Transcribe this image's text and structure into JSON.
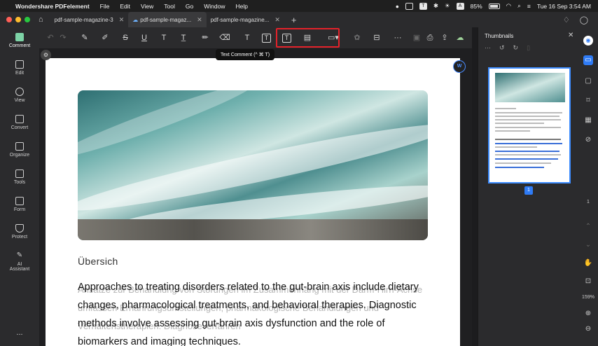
{
  "menubar": {
    "app_name": "Wondershare PDFelement",
    "items": [
      "File",
      "Edit",
      "View",
      "Tool",
      "Go",
      "Window",
      "Help"
    ],
    "battery": "85%",
    "datetime": "Tue 16 Sep  3:54 AM",
    "status_letter": "A"
  },
  "tabs": [
    {
      "label": "pdf-sample-magazine-3"
    },
    {
      "label": "pdf-sample-magaz..."
    },
    {
      "label": "pdf-sample-magazine..."
    }
  ],
  "sidebar": {
    "items": [
      {
        "label": "Comment"
      },
      {
        "label": "Edit"
      },
      {
        "label": "View"
      },
      {
        "label": "Convert"
      },
      {
        "label": "Organize"
      },
      {
        "label": "Tools"
      },
      {
        "label": "Form"
      },
      {
        "label": "Protect"
      },
      {
        "label": "AI"
      },
      {
        "label": "Assistant"
      }
    ],
    "more": "..."
  },
  "toolbar": {
    "tooltip": "Text Comment (^ ⌘ T)",
    "icons": [
      "undo-icon",
      "redo-icon",
      "highlighter-icon",
      "area-highlight-icon",
      "strikethrough-icon",
      "underline-icon",
      "text-icon",
      "text-replace-icon",
      "pencil-icon",
      "eraser-icon",
      "text-comment-icon",
      "text-box-icon",
      "callout-icon",
      "sticky-note-icon",
      "shape-icon",
      "stamp-icon",
      "attachment-icon",
      "more-icon",
      "save-icon",
      "print-icon",
      "share-icon",
      "cloud-icon"
    ]
  },
  "document": {
    "heading": "Übersich",
    "body": "Approaches to treating disorders related to the gut-brain axis include dietary changes, pharmacological treatments, and behavioral therapies. Diagnostic methods involve assessing gut-brain axis dysfunction and the role of biomarkers and imaging techniques.",
    "ghost": "Ansätze zur Behandlung von Störungen im Zusammenhang mit der Darm-Hirn-Achse umfassen Ernährungsumstellungen, pharmakologische Behandlungen und Verhaltenstherapien. Diagnoseverfahren"
  },
  "thumbnails": {
    "title": "Thumbnails",
    "page_number": "1"
  },
  "rightbar": {
    "page": "1",
    "zoom": "159%"
  },
  "colors": {
    "accent": "#2f7bf5",
    "highlight_box": "#e4222a",
    "comment_active": "#7dd3a6"
  }
}
